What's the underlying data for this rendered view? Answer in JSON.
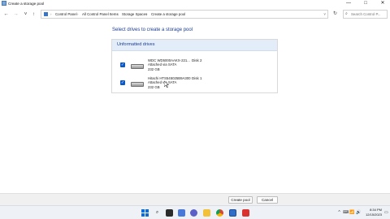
{
  "window": {
    "title": "Create a storage pool",
    "controls": [
      "—",
      "□",
      "✕"
    ]
  },
  "nav": {
    "back": "←",
    "forward": "→",
    "dropdown": "˅",
    "up": "↑",
    "refresh": "↻"
  },
  "breadcrumb": [
    "Control Panel",
    "All Control Panel Items",
    "Storage Spaces",
    "Create a storage pool"
  ],
  "breadcrumb_separator": "›",
  "search": {
    "placeholder": "Search Control P...",
    "icon": "search-icon"
  },
  "page": {
    "heading": "Select drives to create a storage pool"
  },
  "group": {
    "title": "Unformatted drives"
  },
  "drives": [
    {
      "name": "WDC WD5000AAKX-221...",
      "connection": "Attached via SATA",
      "size": "232 GB",
      "disk": "Disk 2",
      "checked": true
    },
    {
      "name": "Hitachi HTS545025B9A300",
      "connection": "Attached via SATA",
      "size": "232 GB",
      "disk": "Disk 1",
      "checked": true
    }
  ],
  "buttons": {
    "create": "Create pool",
    "cancel": "Cancel"
  },
  "taskbar": {
    "clock_time": "8:34 PM",
    "clock_date": "12/15/2023",
    "tray": [
      "^",
      "⌨",
      "📶",
      "🔊"
    ]
  },
  "colors": {
    "accent": "#0a58c6",
    "heading": "#1c3d8f",
    "group_header_bg": "#e3edf9"
  }
}
